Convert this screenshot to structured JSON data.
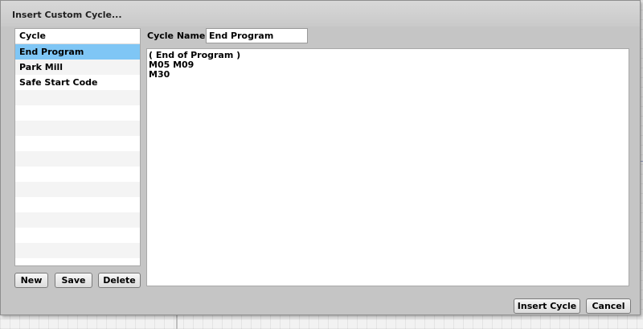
{
  "dialog": {
    "title": "Insert Custom Cycle..."
  },
  "cycle_list": {
    "header": "Cycle",
    "items": [
      {
        "label": "End Program",
        "selected": true
      },
      {
        "label": "Park Mill",
        "selected": false
      },
      {
        "label": "Safe Start Code",
        "selected": false
      }
    ],
    "selected_color": "#7fc6f5"
  },
  "list_buttons": {
    "new_label": "New",
    "save_label": "Save",
    "delete_label": "Delete"
  },
  "editor": {
    "name_label": "Cycle Name:",
    "name_value": "End Program",
    "code": "( End of Program )\nM05 M09\nM30"
  },
  "footer_buttons": {
    "insert_label": "Insert Cycle",
    "cancel_label": "Cancel"
  }
}
